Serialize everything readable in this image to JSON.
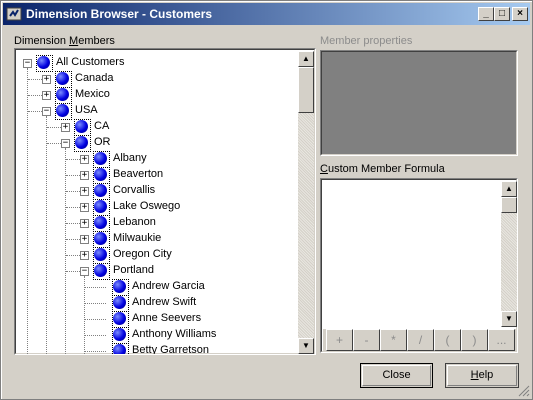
{
  "window": {
    "title": "Dimension Browser - Customers",
    "controls": [
      "minimize",
      "maximize",
      "close"
    ]
  },
  "dimension_members": {
    "label": "Dimension ",
    "label_underlined": "M",
    "label_rest": "embers"
  },
  "tree": {
    "nodes": [
      {
        "label": "All Customers",
        "level": 0,
        "expander": "minus"
      },
      {
        "label": "Canada",
        "level": 1,
        "expander": "plus"
      },
      {
        "label": "Mexico",
        "level": 1,
        "expander": "plus"
      },
      {
        "label": "USA",
        "level": 1,
        "expander": "minus"
      },
      {
        "label": "CA",
        "level": 2,
        "expander": "plus"
      },
      {
        "label": "OR",
        "level": 2,
        "expander": "minus"
      },
      {
        "label": "Albany",
        "level": 3,
        "expander": "plus"
      },
      {
        "label": "Beaverton",
        "level": 3,
        "expander": "plus"
      },
      {
        "label": "Corvallis",
        "level": 3,
        "expander": "plus"
      },
      {
        "label": "Lake Oswego",
        "level": 3,
        "expander": "plus"
      },
      {
        "label": "Lebanon",
        "level": 3,
        "expander": "plus"
      },
      {
        "label": "Milwaukie",
        "level": 3,
        "expander": "plus"
      },
      {
        "label": "Oregon City",
        "level": 3,
        "expander": "plus"
      },
      {
        "label": "Portland",
        "level": 3,
        "expander": "minus"
      },
      {
        "label": "Andrew Garcia",
        "level": 4,
        "expander": "none"
      },
      {
        "label": "Andrew Swift",
        "level": 4,
        "expander": "none"
      },
      {
        "label": "Anne Seevers",
        "level": 4,
        "expander": "none"
      },
      {
        "label": "Anthony Williams",
        "level": 4,
        "expander": "none"
      },
      {
        "label": "Betty Garretson",
        "level": 4,
        "expander": "none"
      }
    ]
  },
  "member_properties": {
    "label": "Member properties"
  },
  "custom_formula": {
    "label_underlined": "C",
    "label_rest": "ustom Member Formula",
    "operators": [
      "+",
      "-",
      "*",
      "/",
      "(",
      ")",
      "..."
    ]
  },
  "buttons": {
    "close": "Close",
    "help_underlined": "H",
    "help_rest": "elp"
  }
}
